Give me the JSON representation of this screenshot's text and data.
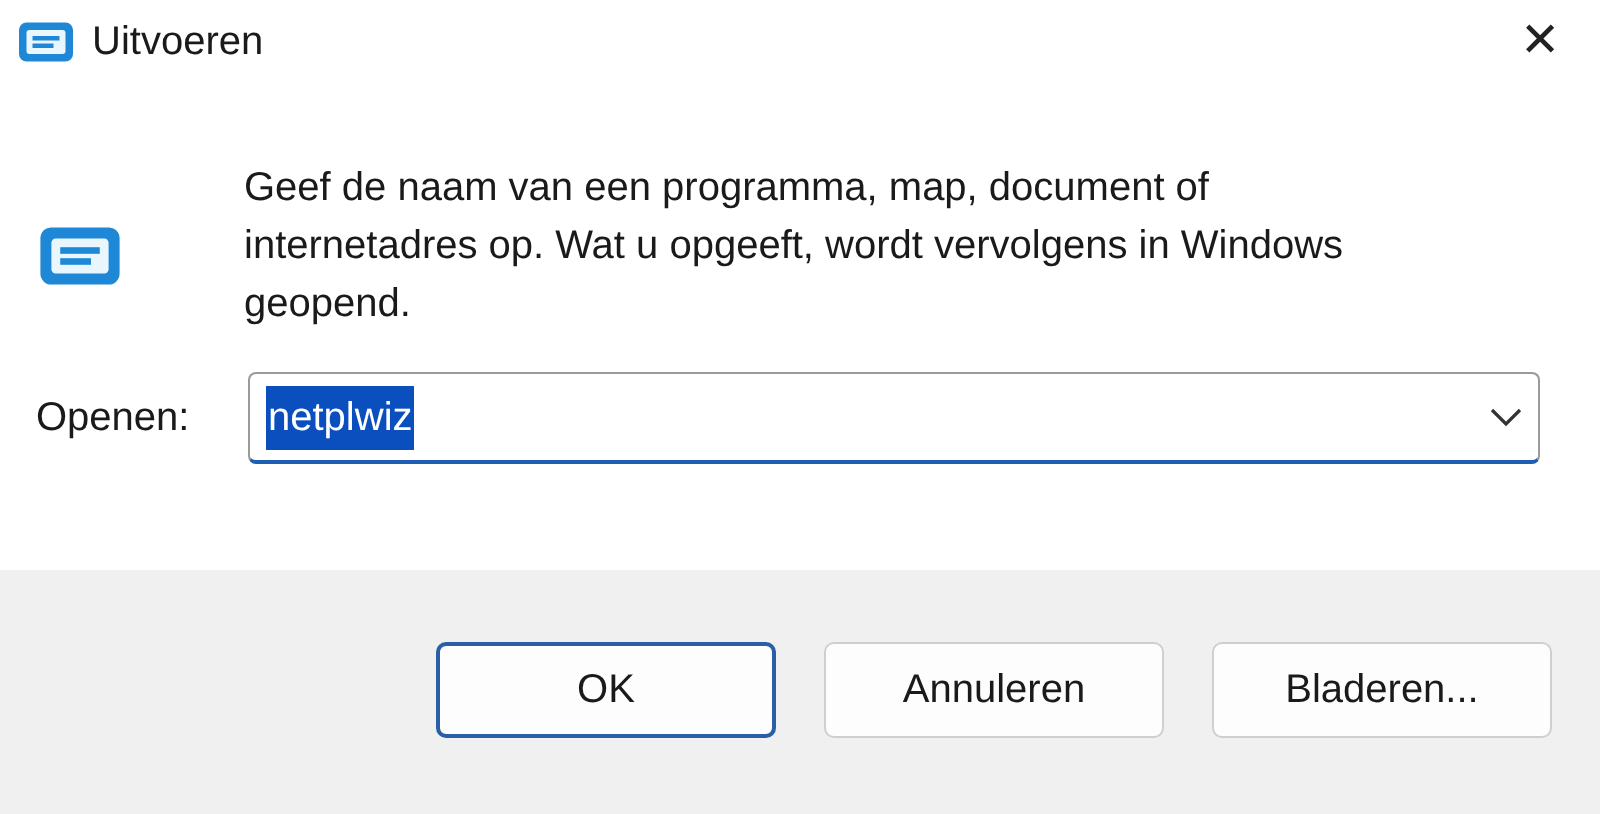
{
  "window": {
    "title": "Uitvoeren",
    "close": "✕"
  },
  "prompt": "Geef de naam van een programma, map, document of internetadres op. Wat u opgeeft, wordt vervolgens in Windows geopend.",
  "open_field": {
    "label": "Openen:",
    "value": "netplwiz",
    "text_selected": true
  },
  "buttons": [
    {
      "label": "OK",
      "default": true
    },
    {
      "label": "Annuleren",
      "default": false
    },
    {
      "label": "Bladeren...",
      "default": false
    }
  ]
}
